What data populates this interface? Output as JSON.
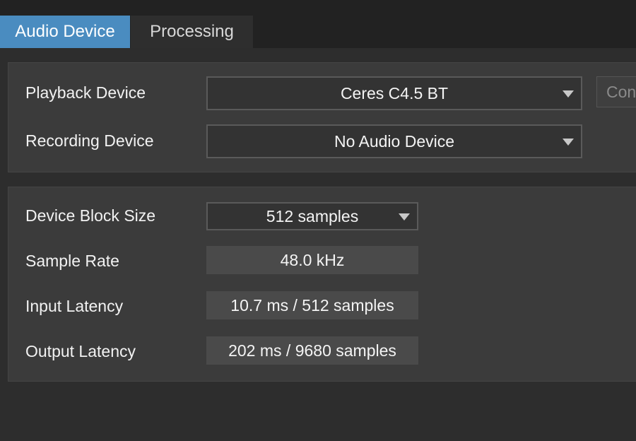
{
  "tabs": [
    {
      "label": "Audio Device",
      "active": true
    },
    {
      "label": "Processing",
      "active": false
    }
  ],
  "devices": {
    "playback_label": "Playback Device",
    "playback_value": "Ceres C4.5 BT",
    "recording_label": "Recording Device",
    "recording_value": "No Audio Device",
    "config_button_label": "Con"
  },
  "info": {
    "block_size_label": "Device Block Size",
    "block_size_value": "512 samples",
    "sample_rate_label": "Sample Rate",
    "sample_rate_value": "48.0 kHz",
    "input_latency_label": "Input Latency",
    "input_latency_value": "10.7 ms / 512 samples",
    "output_latency_label": "Output Latency",
    "output_latency_value": "202 ms / 9680 samples"
  },
  "icons": {
    "dropdown": "chevron-down-icon"
  },
  "colors": {
    "accent": "#4a8cc0",
    "background": "#2d2d2d",
    "panel": "#3b3b3b"
  }
}
